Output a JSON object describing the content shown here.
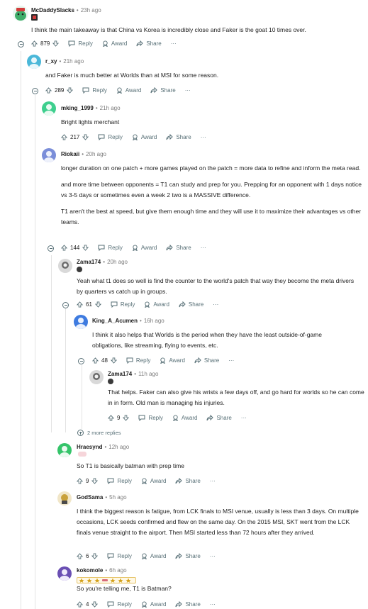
{
  "actions": {
    "reply": "Reply",
    "award": "Award",
    "share": "Share",
    "more": "···"
  },
  "comments": [
    {
      "user": "McDaddySlacks",
      "sep": "•",
      "time": "23h ago",
      "votes": "879",
      "body": [
        "I think the main takeaway is that China vs Korea is incredibly close and Faker is the goat 10 times over."
      ]
    },
    {
      "user": "r_xy",
      "sep": "•",
      "time": "21h ago",
      "votes": "289",
      "body": [
        "and Faker is much better at Worlds than at MSI for some reason."
      ]
    },
    {
      "user": "mking_1999",
      "sep": "•",
      "time": "21h ago",
      "votes": "217",
      "body": [
        "Bright lights merchant"
      ]
    },
    {
      "user": "Riokaii",
      "sep": "•",
      "time": "20h ago",
      "votes": "144",
      "body": [
        "longer duration on one patch + more games played on the patch = more data to refine and inform the meta read.",
        "and more time between opponents = T1 can study and prep for you. Prepping for an opponent with 1 days notice vs 3-5 days or sometimes even a week 2 two is a MASSIVE difference.",
        "T1 aren't the best at speed, but give them enough time and they will use it to maximize their advantages vs other teams."
      ]
    },
    {
      "user": "Zama174",
      "sep": "•",
      "time": "20h ago",
      "votes": "61",
      "body": [
        "Yeah what t1 does so well is find the counter to the world's patch that way they become the meta drivers by quarters vs catch up in groups."
      ]
    },
    {
      "user": "King_A_Acumen",
      "sep": "•",
      "time": "16h ago",
      "votes": "48",
      "body": [
        "I think it also helps that Worlds is the period when they have the least outside-of-game obligations, like streaming, flying to events, etc."
      ]
    },
    {
      "user": "Zama174",
      "sep": "•",
      "time": "11h ago",
      "votes": "9",
      "body": [
        "That helps. Faker can also give his wrists a few days off, and go hard for worlds so he can come in in form. Old man is managing his injuries."
      ]
    },
    {
      "user": "Hraesynd",
      "sep": "•",
      "time": "12h ago",
      "votes": "9",
      "body": [
        "So T1 is basically batman with prep time"
      ]
    },
    {
      "user": "GodSama",
      "sep": "•",
      "time": "5h ago",
      "votes": "6",
      "body": [
        "I think the biggest reason is fatigue, from LCK finals to MSI venue, usually is less than 3 days. On multiple occasions, LCK seeds confirmed and flew on the same day. On the 2015 MSI, SKT went from the LCK finals venue straight to the airport. Then MSI started less than 72 hours after they arrived."
      ]
    },
    {
      "user": "kokomole",
      "sep": "•",
      "time": "6h ago",
      "votes": "4",
      "body": [
        "So you're telling me, T1 is Batman?"
      ]
    }
  ],
  "more_replies": "2 more replies",
  "colors": {
    "icon": "#576f76",
    "thread_line": "#e3e3e3",
    "muted": "#7c7c7c"
  }
}
